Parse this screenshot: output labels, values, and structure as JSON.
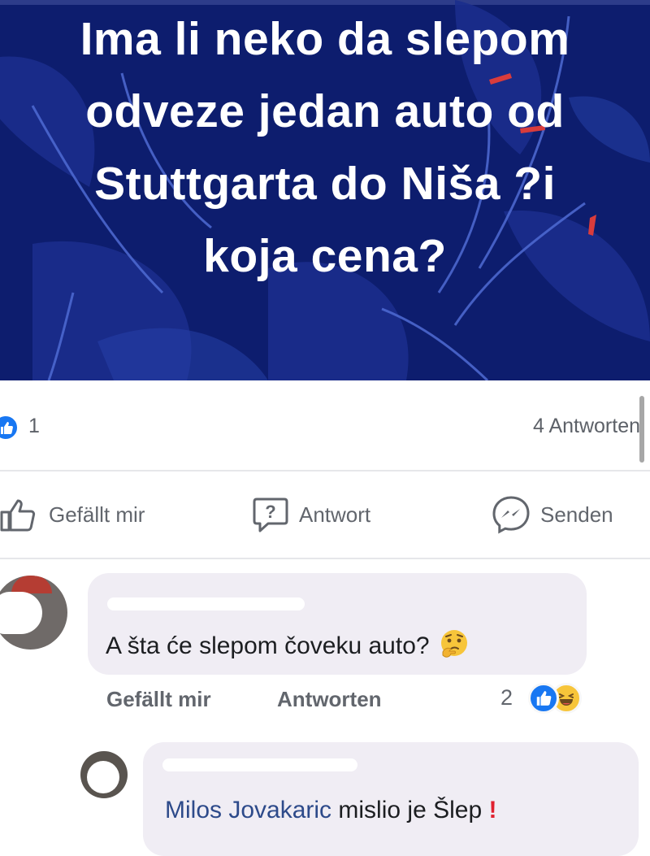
{
  "post": {
    "banner_lines": [
      "Ima li neko da slepom",
      "odveze jedan auto od",
      "Stuttgarta do Niša ?i",
      "koja cena?"
    ],
    "background_color": "#0d1d6e"
  },
  "summary": {
    "likes": "1",
    "replies": "4 Antworten"
  },
  "actions": {
    "like_label": "Gefällt mir",
    "reply_label": "Antwort",
    "send_label": "Senden"
  },
  "comments": [
    {
      "text": "A šta će slepom čoveku auto?",
      "emoji": "thinking-face-icon",
      "like_label": "Gefällt mir",
      "reply_label": "Antworten",
      "reaction_count": "2",
      "reactions": [
        "like-icon",
        "haha-icon"
      ]
    },
    {
      "mention": "Milos Jovakaric",
      "text": " mislio je Šlep",
      "exclamation": "!"
    }
  ],
  "colors": {
    "accent": "#1877f2",
    "mention": "#2d4a8a",
    "secondary_text": "#62666d"
  }
}
